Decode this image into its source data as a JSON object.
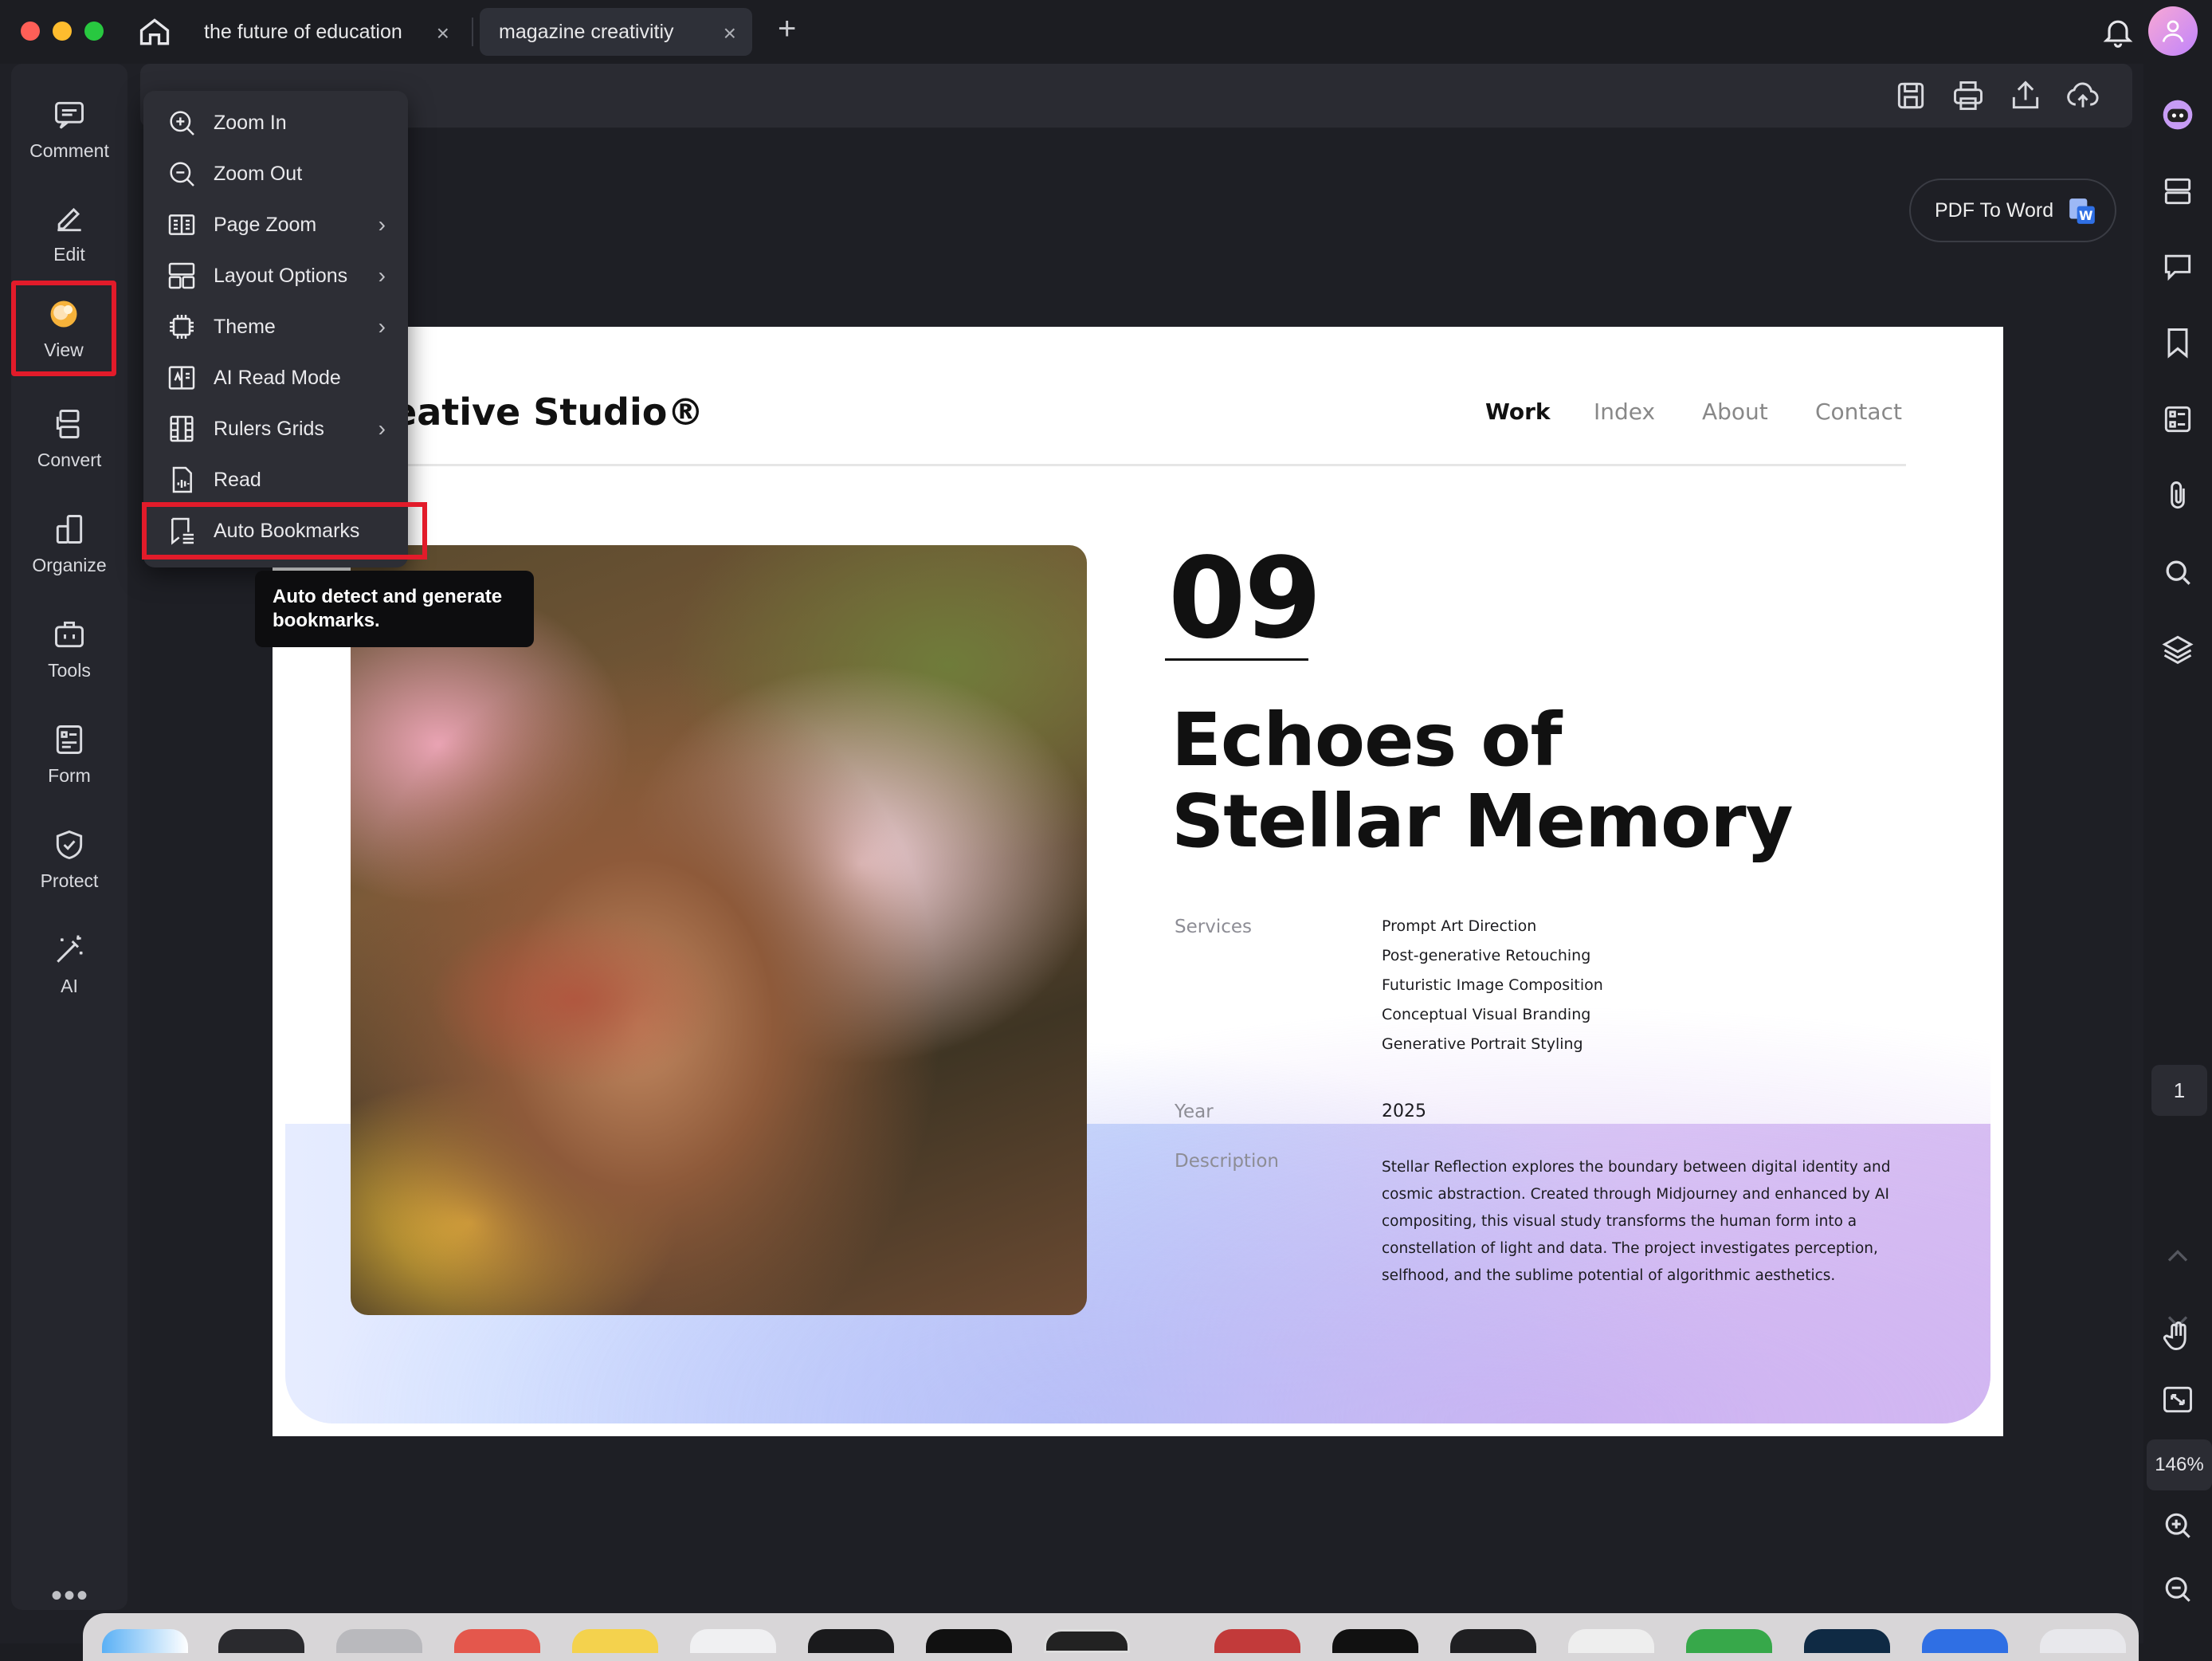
{
  "tabs": [
    {
      "label": "the future of education"
    },
    {
      "label": "magazine creativitiy"
    }
  ],
  "left_rail": {
    "items": [
      {
        "label": "Comment",
        "icon": "comment-icon"
      },
      {
        "label": "Edit",
        "icon": "edit-icon"
      },
      {
        "label": "View",
        "icon": "view-icon"
      },
      {
        "label": "Convert",
        "icon": "convert-icon"
      },
      {
        "label": "Organize",
        "icon": "organize-icon"
      },
      {
        "label": "Tools",
        "icon": "tools-icon"
      },
      {
        "label": "Form",
        "icon": "form-icon"
      },
      {
        "label": "Protect",
        "icon": "protect-icon"
      },
      {
        "label": "AI",
        "icon": "ai-icon"
      }
    ],
    "more": "•••"
  },
  "view_menu": {
    "items": [
      {
        "label": "Zoom In",
        "icon": "zoom-in-icon",
        "submenu": false
      },
      {
        "label": "Zoom Out",
        "icon": "zoom-out-icon",
        "submenu": false
      },
      {
        "label": "Page Zoom",
        "icon": "page-zoom-icon",
        "submenu": true
      },
      {
        "label": "Layout Options",
        "icon": "layout-icon",
        "submenu": true
      },
      {
        "label": "Theme",
        "icon": "theme-icon",
        "submenu": true
      },
      {
        "label": "AI Read Mode",
        "icon": "ai-read-icon",
        "submenu": false
      },
      {
        "label": "Rulers Grids",
        "icon": "rulers-icon",
        "submenu": true
      },
      {
        "label": "Read",
        "icon": "read-icon",
        "submenu": false
      },
      {
        "label": "Auto Bookmarks",
        "icon": "auto-bookmark-icon",
        "submenu": false
      }
    ],
    "tooltip": "Auto detect and generate bookmarks."
  },
  "pdf_to_word": {
    "label": "PDF To Word"
  },
  "page_indicator": "1",
  "zoom_level": "146%",
  "document": {
    "studio": "eative Studio®",
    "nav": [
      "Work",
      "Index",
      "About",
      "Contact"
    ],
    "number": "09",
    "headline_line1": "Echoes of",
    "headline_line2": "Stellar Memory",
    "services_label": "Services",
    "services": [
      "Prompt Art Direction",
      "Post-generative Retouching",
      "Futuristic Image Composition",
      "Conceptual Visual Branding",
      "Generative Portrait Styling"
    ],
    "year_label": "Year",
    "year": "2025",
    "description_label": "Description",
    "description": "Stellar Reflection explores the boundary between digital identity and cosmic abstraction. Created through Midjourney and enhanced by AI compositing, this visual study transforms the human form into a constellation of light and data. The project investigates perception, selfhood, and the sublime potential of algorithmic aesthetics."
  },
  "colors": {
    "highlight": "#e21b2a",
    "background": "#1f2026",
    "menu": "#2d2e35"
  }
}
